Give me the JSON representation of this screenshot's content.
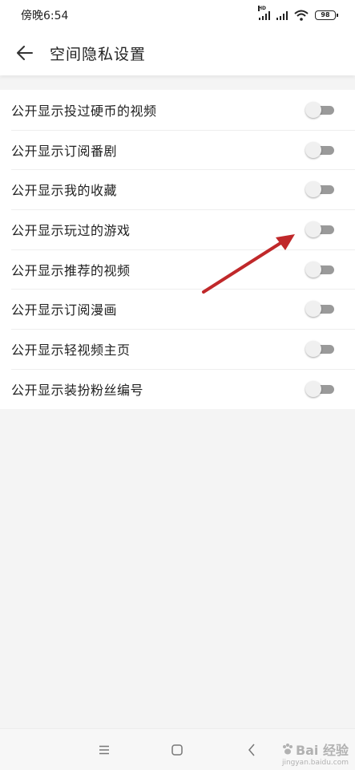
{
  "status_bar": {
    "time": "傍晚6:54",
    "network_badge": "HD",
    "battery": "98"
  },
  "header": {
    "title": "空间隐私设置"
  },
  "settings": [
    {
      "label": "公开显示投过硬币的视频",
      "enabled": false
    },
    {
      "label": "公开显示订阅番剧",
      "enabled": false
    },
    {
      "label": "公开显示我的收藏",
      "enabled": false
    },
    {
      "label": "公开显示玩过的游戏",
      "enabled": false
    },
    {
      "label": "公开显示推荐的视频",
      "enabled": false
    },
    {
      "label": "公开显示订阅漫画",
      "enabled": false
    },
    {
      "label": "公开显示轻视频主页",
      "enabled": false
    },
    {
      "label": "公开显示装扮粉丝编号",
      "enabled": false
    }
  ],
  "annotation": {
    "color": "#c0282a",
    "points_to": "公开显示玩过的游戏"
  },
  "nav": {
    "icons": [
      "menu-icon",
      "home-square-icon",
      "back-chevron-icon"
    ]
  },
  "watermark": {
    "main": "Bai 经验",
    "sub": "jingyan.baidu.com"
  },
  "colors": {
    "toggle_track_off": "#9a9a9a",
    "toggle_knob_off": "#f0f0f0",
    "background": "#f4f4f4"
  }
}
